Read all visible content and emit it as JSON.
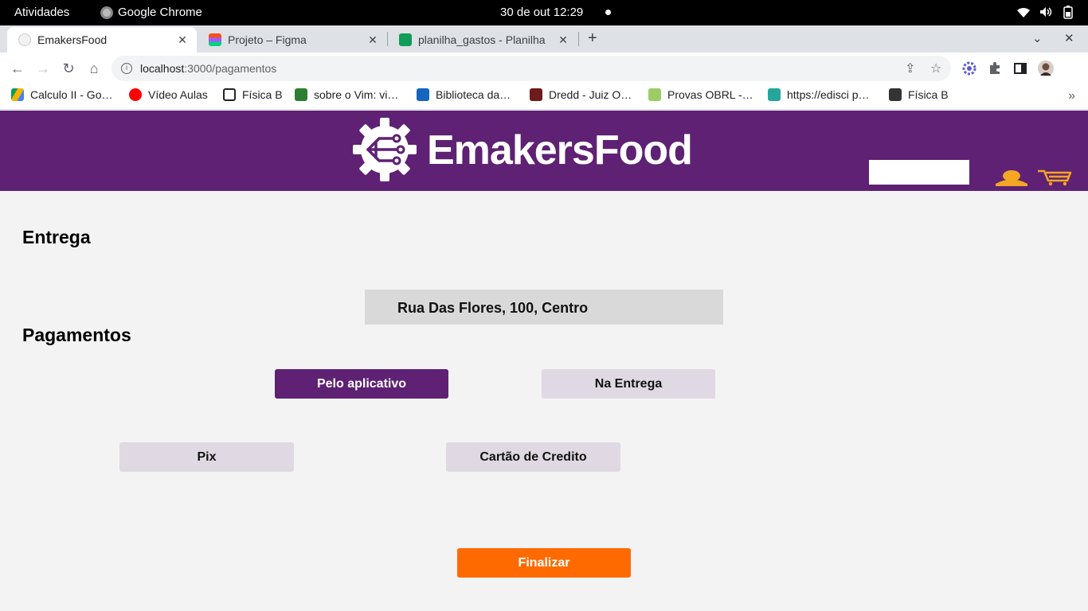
{
  "os_bar": {
    "activities": "Atividades",
    "app_name": "Google Chrome",
    "clock": "30 de out  12:29"
  },
  "tabs": [
    {
      "title": "EmakersFood",
      "active": true
    },
    {
      "title": "Projeto – Figma",
      "active": false
    },
    {
      "title": "planilha_gastos - Planilha",
      "active": false
    }
  ],
  "toolbar": {
    "url_host": "localhost",
    "url_path": ":3000/pagamentos"
  },
  "bookmarks": [
    {
      "label": "Calculo II - Go…",
      "icon": "google-drive-icon",
      "color": "#1a73e8"
    },
    {
      "label": "Vídeo Aulas",
      "icon": "youtube-icon",
      "color": "#ff0000"
    },
    {
      "label": "Física B",
      "icon": "notion-icon",
      "color": "#222222"
    },
    {
      "label": "sobre o Vim: vi…",
      "icon": "vim-icon",
      "color": "#2e7d32"
    },
    {
      "label": "Biblioteca da…",
      "icon": "library-icon",
      "color": "#1565c0"
    },
    {
      "label": "Dredd - Juiz O…",
      "icon": "movie-icon",
      "color": "#6d1b1b"
    },
    {
      "label": "Provas OBRL -…",
      "icon": "check-icon",
      "color": "#9ccc65"
    },
    {
      "label": "https://edisci p…",
      "icon": "cloud-icon",
      "color": "#26a69a"
    },
    {
      "label": "Física B",
      "icon": "folder-icon",
      "color": "#333333"
    }
  ],
  "site": {
    "brand": "EmakersFood",
    "colors": {
      "primary": "#5e2173",
      "accent": "#ff6a00",
      "icon": "#f5a623"
    }
  },
  "checkout": {
    "delivery_heading": "Entrega",
    "address": "Rua Das Flores, 100, Centro",
    "payments_heading": "Pagamentos",
    "pay_app": "Pelo aplicativo",
    "pay_delivery": "Na Entrega",
    "method_pix": "Pix",
    "method_card": "Cartão de Credito",
    "finish": "Finalizar"
  }
}
